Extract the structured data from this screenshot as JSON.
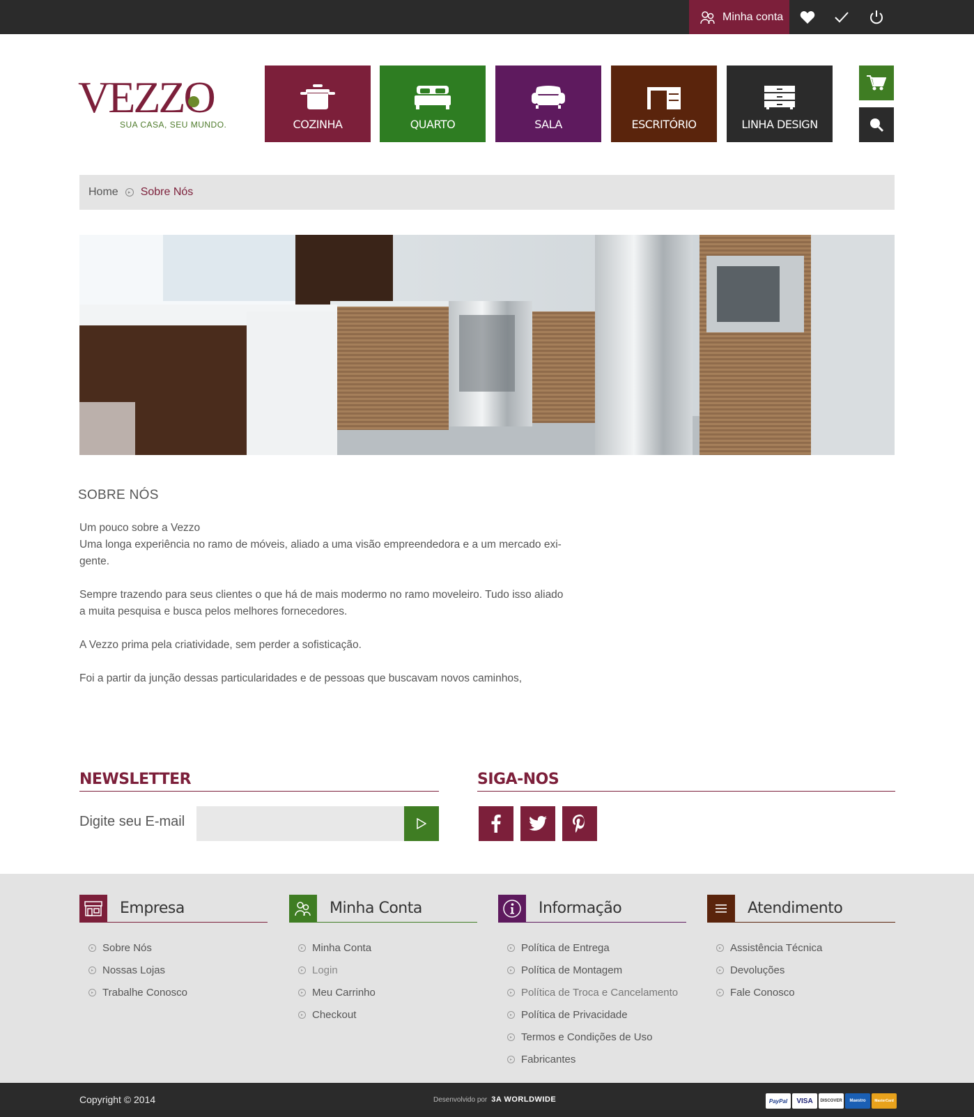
{
  "topbar": {
    "account_label": "Minha conta",
    "icons": [
      "user-icon",
      "heart-icon",
      "check-icon",
      "power-icon"
    ]
  },
  "logo": {
    "name": "VEZZO",
    "tagline": "SUA CASA, SEU MUNDO."
  },
  "categories": [
    {
      "label": "COZINHA",
      "icon": "pot-icon",
      "color": "#7c1f3a"
    },
    {
      "label": "QUARTO",
      "icon": "bed-icon",
      "color": "#2e7d22"
    },
    {
      "label": "SALA",
      "icon": "sofa-icon",
      "color": "#5e1a5e"
    },
    {
      "label": "ESCRITÓRIO",
      "icon": "desk-icon",
      "color": "#5a240c"
    },
    {
      "label": "LINHA DESIGN",
      "icon": "drawers-icon",
      "color": "#2b2b2b"
    }
  ],
  "side_buttons": {
    "cart_color": "#3f7d23",
    "search_color": "#2b2b2b"
  },
  "breadcrumb": {
    "home": "Home",
    "current": "Sobre Nós"
  },
  "about": {
    "title": "SOBRE NÓS",
    "paragraphs": [
      "Um pouco sobre a Vezzo\nUma longa experiência no ramo de móveis, aliado a uma visão empreendedora e a um mercado exi-\ngente.",
      "Sempre trazendo para seus clientes o que há de mais modermo no ramo moveleiro. Tudo isso aliado a muita pesquisa e busca pelos melhores fornecedores.",
      "A Vezzo prima pela criatividade, sem perder a sofisticação.",
      "Foi a partir da junção dessas particularidades e de pessoas que buscavam novos caminhos,"
    ]
  },
  "newsletter": {
    "heading": "NEWSLETTER",
    "label": "Digite seu E-mail",
    "placeholder": ""
  },
  "social": {
    "heading": "SIGA-NOS",
    "icons": [
      "facebook-icon",
      "twitter-icon",
      "pinterest-icon"
    ]
  },
  "footer": {
    "columns": [
      {
        "title": "Empresa",
        "color": "#7c1f3a",
        "links": [
          "Sobre Nós",
          "Nossas Lojas",
          "Trabalhe Conosco"
        ]
      },
      {
        "title": "Minha Conta",
        "color": "#3f7d23",
        "links": [
          "Minha Conta",
          "Login",
          "Meu Carrinho",
          "Checkout"
        ]
      },
      {
        "title": "Informação",
        "color": "#5e1a5e",
        "links": [
          "Política de Entrega",
          "Política de Montagem",
          "Política de Troca e Cancelamento",
          "Política de Privacidade",
          "Termos e Condições de Uso",
          "Fabricantes"
        ]
      },
      {
        "title": "Atendimento",
        "color": "#5a240c",
        "links": [
          "Assistência Técnica",
          "Devoluções",
          "Fale Conosco"
        ]
      }
    ]
  },
  "bottom": {
    "copyright": "Copyright © 2014",
    "developed_by": "Desenvolvido por",
    "developer": "3A WORLDWIDE",
    "payments": [
      "PayPal",
      "VISA",
      "DISCOVER",
      "Maestro",
      "MasterCard"
    ]
  }
}
